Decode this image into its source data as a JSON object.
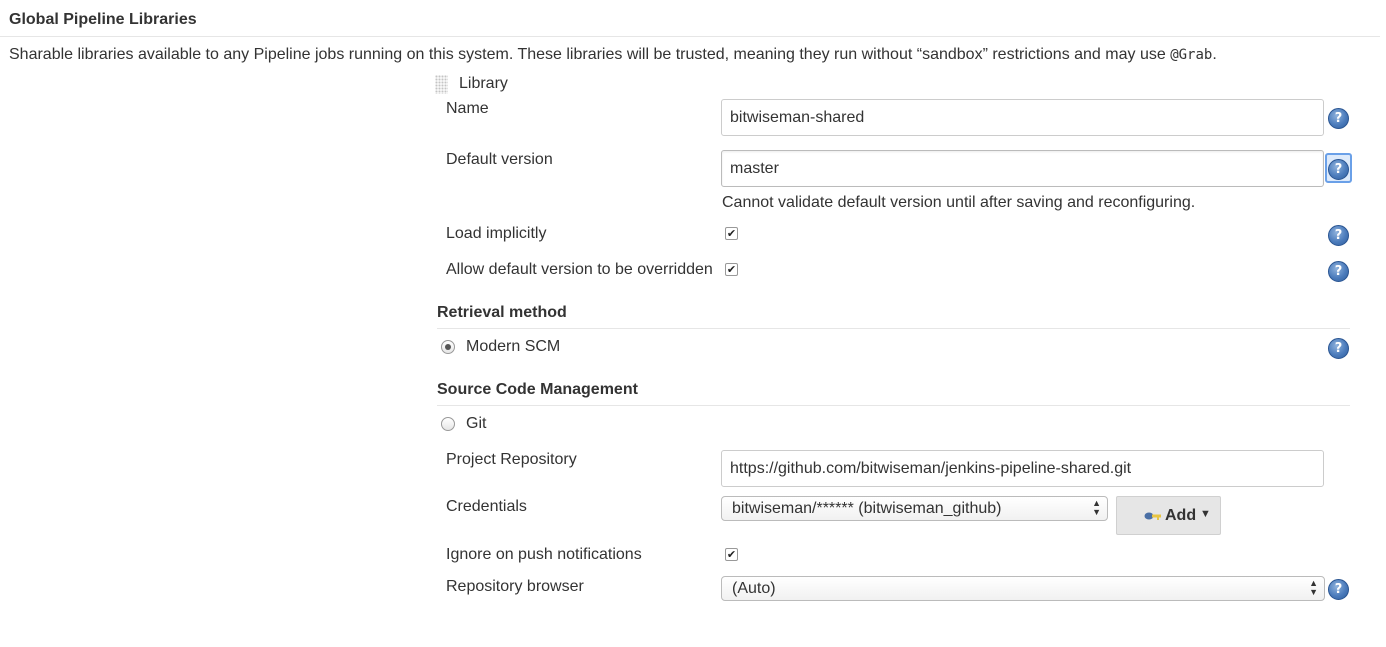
{
  "section": {
    "title": "Global Pipeline Libraries",
    "description": "Sharable libraries available to any Pipeline jobs running on this system. These libraries will be trusted, meaning they run without “sandbox” restrictions and may use ",
    "code": "@Grab",
    "description_end": "."
  },
  "library": {
    "label": "Library",
    "name_label": "Name",
    "name_value": "bitwiseman-shared",
    "default_version_label": "Default version",
    "default_version_value": "master",
    "validation_message": "Cannot validate default version until after saving and reconfiguring.",
    "load_implicitly_label": "Load implicitly",
    "load_implicitly_checked": true,
    "allow_override_label": "Allow default version to be overridden",
    "allow_override_checked": true
  },
  "retrieval": {
    "heading": "Retrieval method",
    "option_label": "Modern SCM",
    "selected": true
  },
  "scm": {
    "heading": "Source Code Management",
    "git_label": "Git",
    "git_selected": false,
    "project_repository_label": "Project Repository",
    "project_repository_value": "https://github.com/bitwiseman/jenkins-pipeline-shared.git",
    "credentials_label": "Credentials",
    "credentials_value": "bitwiseman/****** (bitwiseman_github)",
    "add_button_label": "Add",
    "ignore_push_label": "Ignore on push notifications",
    "ignore_push_checked": true,
    "repository_browser_label": "Repository browser",
    "repository_browser_value": "(Auto)"
  },
  "help_glyph": "?",
  "check_glyph": "✔",
  "icons": {
    "help": "help-icon",
    "drag": "drag-handle-icon",
    "key": "key-icon",
    "caret": "caret-down-icon"
  },
  "colors": {
    "help_blue": "#4c7cbc",
    "focus_blue": "#6aa0e8"
  }
}
